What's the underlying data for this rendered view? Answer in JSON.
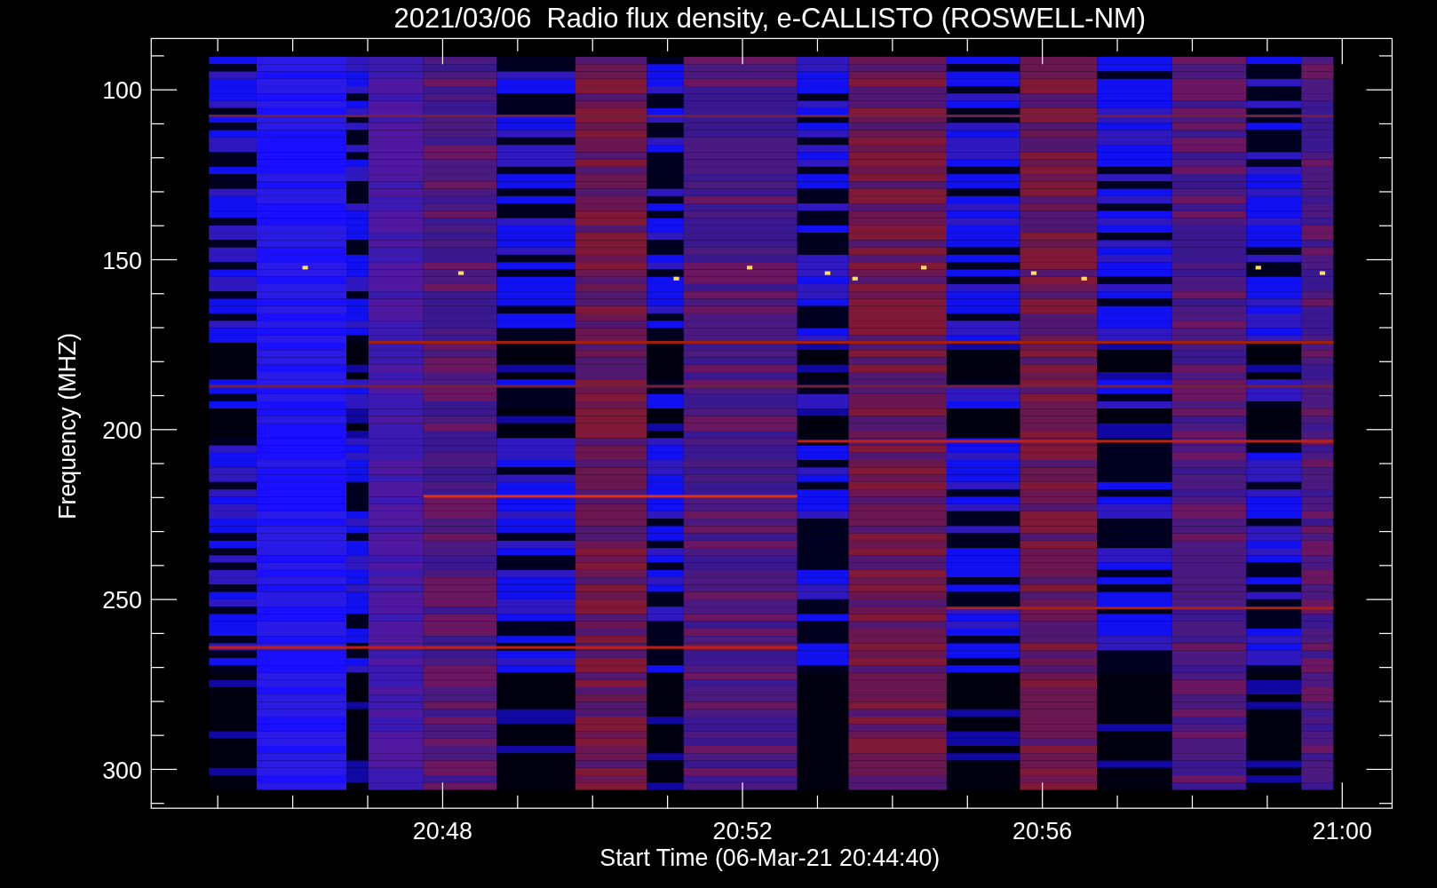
{
  "chart": {
    "title": "2021/03/06  Radio flux density, e-CALLISTO (ROSWELL-NM)",
    "ylabel": "Frequency (MHZ)",
    "xlabel": "Start Time (06-Mar-21 20:44:40)",
    "yticks": [
      "100",
      "150",
      "200",
      "250",
      "300"
    ],
    "xticks": [
      "20:48",
      "20:52",
      "20:56",
      "21:00"
    ]
  }
}
